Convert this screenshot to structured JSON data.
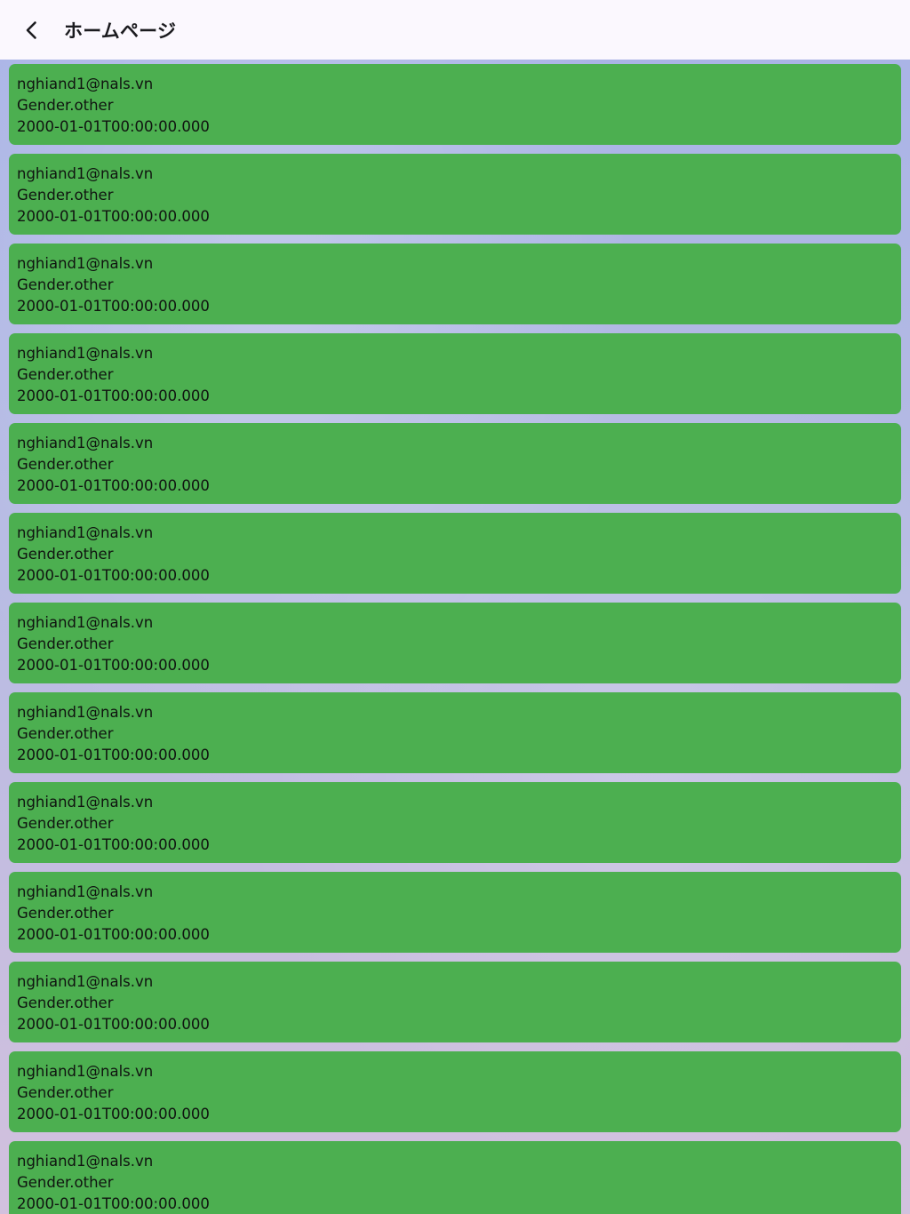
{
  "appbar": {
    "title": "ホームページ",
    "back_icon": "chevron-left-icon"
  },
  "colors": {
    "appbar_bg": "#fbf8fe",
    "card_bg": "#4caf50",
    "text": "#101410"
  },
  "users": [
    {
      "email": "nghiand1@nals.vn",
      "gender": "Gender.other",
      "birthday": "2000-01-01T00:00:00.000"
    },
    {
      "email": "nghiand1@nals.vn",
      "gender": "Gender.other",
      "birthday": "2000-01-01T00:00:00.000"
    },
    {
      "email": "nghiand1@nals.vn",
      "gender": "Gender.other",
      "birthday": "2000-01-01T00:00:00.000"
    },
    {
      "email": "nghiand1@nals.vn",
      "gender": "Gender.other",
      "birthday": "2000-01-01T00:00:00.000"
    },
    {
      "email": "nghiand1@nals.vn",
      "gender": "Gender.other",
      "birthday": "2000-01-01T00:00:00.000"
    },
    {
      "email": "nghiand1@nals.vn",
      "gender": "Gender.other",
      "birthday": "2000-01-01T00:00:00.000"
    },
    {
      "email": "nghiand1@nals.vn",
      "gender": "Gender.other",
      "birthday": "2000-01-01T00:00:00.000"
    },
    {
      "email": "nghiand1@nals.vn",
      "gender": "Gender.other",
      "birthday": "2000-01-01T00:00:00.000"
    },
    {
      "email": "nghiand1@nals.vn",
      "gender": "Gender.other",
      "birthday": "2000-01-01T00:00:00.000"
    },
    {
      "email": "nghiand1@nals.vn",
      "gender": "Gender.other",
      "birthday": "2000-01-01T00:00:00.000"
    },
    {
      "email": "nghiand1@nals.vn",
      "gender": "Gender.other",
      "birthday": "2000-01-01T00:00:00.000"
    },
    {
      "email": "nghiand1@nals.vn",
      "gender": "Gender.other",
      "birthday": "2000-01-01T00:00:00.000"
    },
    {
      "email": "nghiand1@nals.vn",
      "gender": "Gender.other",
      "birthday": "2000-01-01T00:00:00.000"
    }
  ]
}
